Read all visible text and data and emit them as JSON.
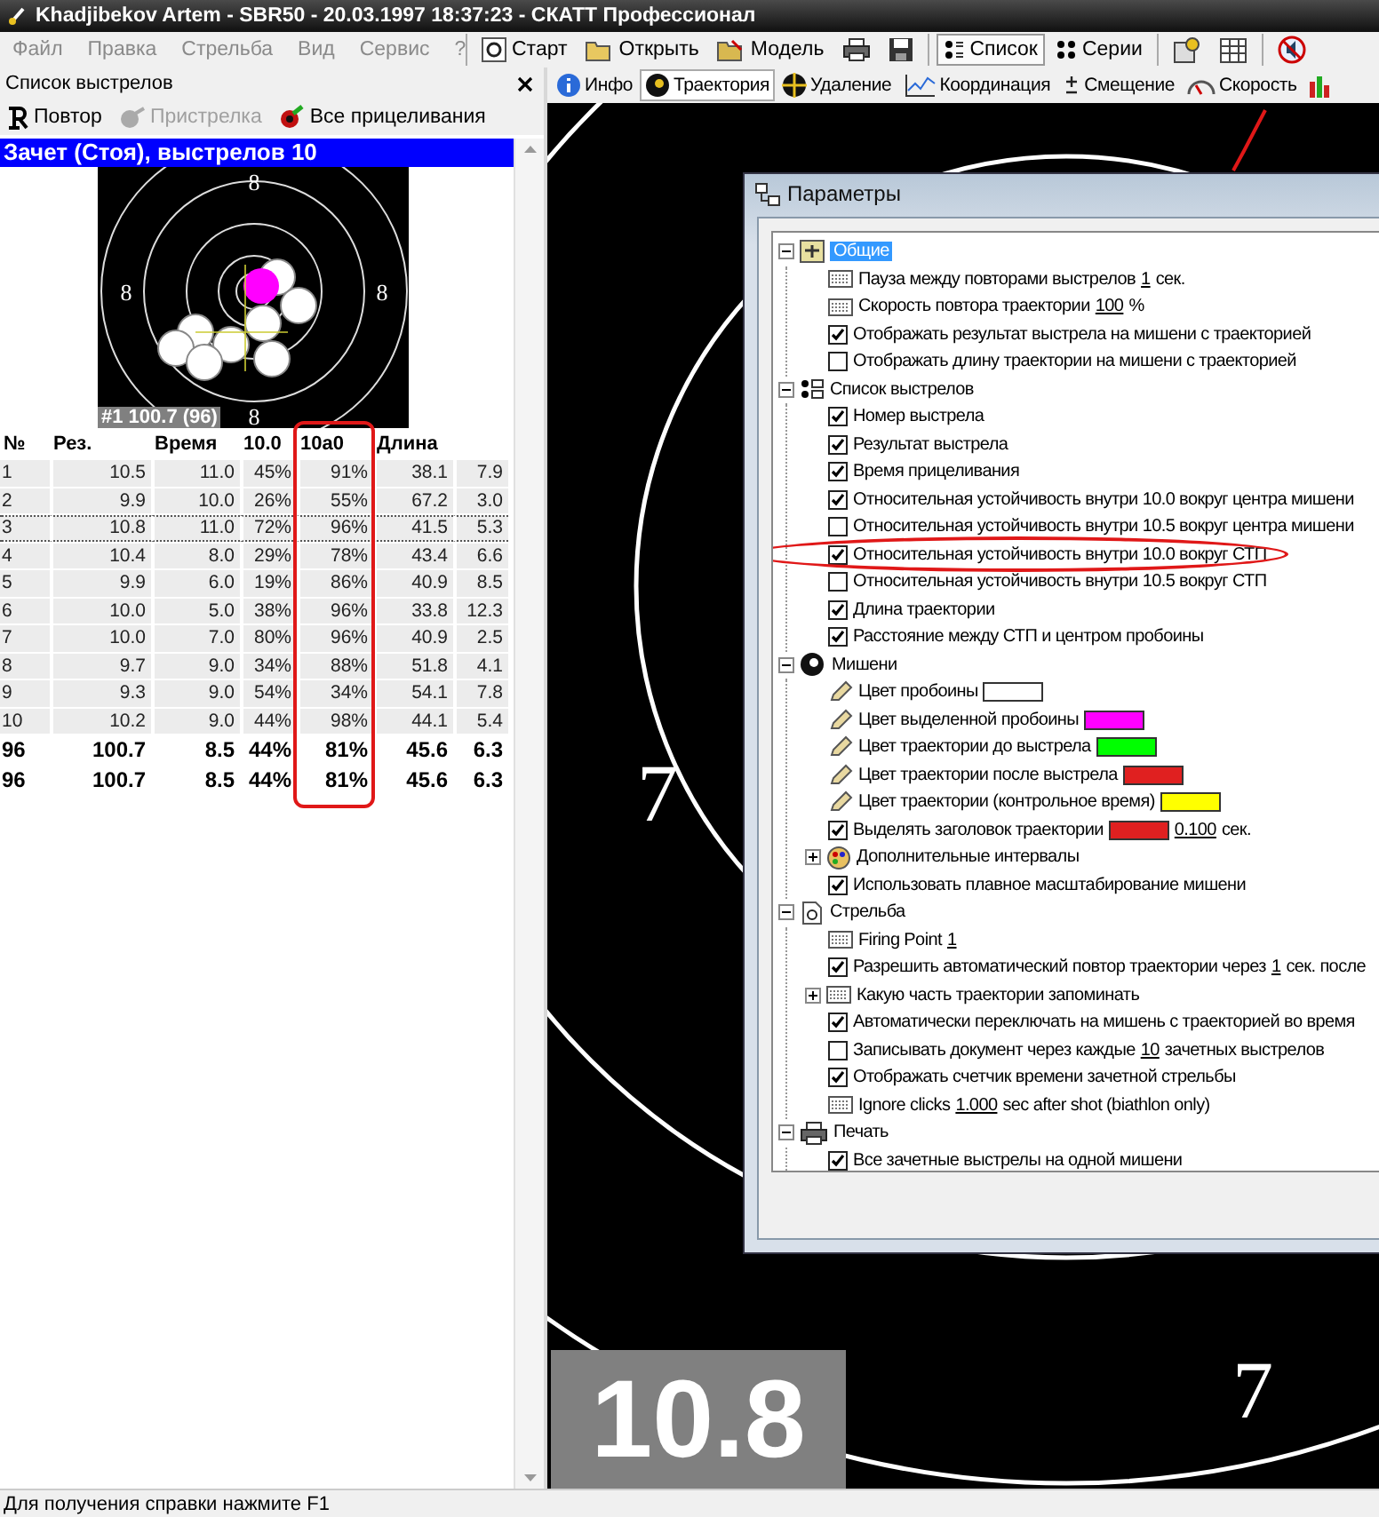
{
  "window": {
    "title": "Khadjibekov Artem - SBR50 - 20.03.1997 18:37:23 - СКАТТ Профессионал"
  },
  "menu": [
    {
      "label": "Файл",
      "disabled": true
    },
    {
      "label": "Правка",
      "disabled": true
    },
    {
      "label": "Стрельба",
      "disabled": true
    },
    {
      "label": "Вид",
      "disabled": true
    },
    {
      "label": "Сервис",
      "disabled": true
    },
    {
      "label": "?",
      "disabled": true
    }
  ],
  "toolbar": {
    "groups": [
      [
        {
          "kind": "start",
          "label": "Старт",
          "pressed": false
        },
        {
          "kind": "open",
          "label": "Открыть",
          "pressed": false
        },
        {
          "kind": "model",
          "label": "Модель",
          "pressed": false
        },
        {
          "kind": "print",
          "pressed": false
        },
        {
          "kind": "save",
          "pressed": false
        }
      ],
      [
        {
          "kind": "list",
          "label": "Список",
          "pressed": true
        },
        {
          "kind": "series",
          "label": "Серии",
          "pressed": false
        }
      ],
      [
        {
          "kind": "settings",
          "pressed": false
        },
        {
          "kind": "export",
          "pressed": false
        }
      ],
      [
        {
          "kind": "mute",
          "pressed": false
        }
      ]
    ]
  },
  "shot_panel": {
    "title": "Список выстрелов",
    "actions": [
      {
        "kind": "replay",
        "label": "Повтор",
        "disabled": false
      },
      {
        "kind": "zeroing",
        "label": "Пристрелка",
        "disabled": true
      },
      {
        "kind": "aims",
        "label": "Все прицеливания",
        "disabled": false
      }
    ],
    "group_header": "Зачет (Стоя), выстрелов 10",
    "mini_target": {
      "ring_labels": [
        "8",
        "8",
        "8",
        "8"
      ],
      "caption": "#1 100.7 (96)"
    },
    "table": {
      "columns": [
        {
          "label": "№"
        },
        {
          "label": "Рез."
        },
        {
          "label": "Время"
        },
        {
          "label": "10.0"
        },
        {
          "label": "10a0",
          "highlighted": true
        },
        {
          "label": "Длина"
        }
      ],
      "rows": [
        {
          "focused": false,
          "cells": [
            "1",
            "10.5",
            "11.0",
            "45%",
            "91%",
            "38.1",
            "7.9"
          ]
        },
        {
          "focused": false,
          "cells": [
            "2",
            "9.9",
            "10.0",
            "26%",
            "55%",
            "67.2",
            "3.0"
          ]
        },
        {
          "focused": true,
          "cells": [
            "3",
            "10.8",
            "11.0",
            "72%",
            "96%",
            "41.5",
            "5.3"
          ]
        },
        {
          "focused": false,
          "cells": [
            "4",
            "10.4",
            "8.0",
            "29%",
            "78%",
            "43.4",
            "6.6"
          ]
        },
        {
          "focused": false,
          "cells": [
            "5",
            "9.9",
            "6.0",
            "19%",
            "86%",
            "40.9",
            "8.5"
          ]
        },
        {
          "focused": false,
          "cells": [
            "6",
            "10.0",
            "5.0",
            "38%",
            "96%",
            "33.8",
            "12.3"
          ]
        },
        {
          "focused": false,
          "cells": [
            "7",
            "10.0",
            "7.0",
            "80%",
            "96%",
            "40.9",
            "2.5"
          ]
        },
        {
          "focused": false,
          "cells": [
            "8",
            "9.7",
            "9.0",
            "34%",
            "88%",
            "51.8",
            "4.1"
          ]
        },
        {
          "focused": false,
          "cells": [
            "9",
            "9.3",
            "9.0",
            "54%",
            "34%",
            "54.1",
            "7.8"
          ]
        },
        {
          "focused": false,
          "cells": [
            "10",
            "10.2",
            "9.0",
            "44%",
            "98%",
            "44.1",
            "5.4"
          ]
        }
      ],
      "totals": [
        [
          "96",
          "100.7",
          "8.5",
          "44%",
          "81%",
          "45.6",
          "6.3"
        ],
        [
          "96",
          "100.7",
          "8.5",
          "44%",
          "81%",
          "45.6",
          "6.3"
        ]
      ]
    }
  },
  "view_tabs": [
    {
      "kind": "info",
      "label": "Инфо",
      "selected": false
    },
    {
      "kind": "trajectory",
      "label": "Траектория",
      "selected": true
    },
    {
      "kind": "distance",
      "label": "Удаление",
      "selected": false
    },
    {
      "kind": "coordination",
      "label": "Координация",
      "selected": false
    },
    {
      "kind": "offset",
      "label": "Смещение",
      "selected": false
    },
    {
      "kind": "speed",
      "label": "Скорость",
      "selected": false
    },
    {
      "kind": "chart",
      "selected": false
    }
  ],
  "big_target": {
    "ring_labels": [
      "7",
      "7"
    ],
    "score": "10.8"
  },
  "dialog": {
    "title": "Параметры",
    "sections": [
      {
        "kind": "general",
        "label": "Общие",
        "selected": true,
        "expanded": true,
        "children": [
          {
            "kind": "value",
            "label": "Пауза между повторами выстрелов ",
            "value": "1",
            "suffix": " сек."
          },
          {
            "kind": "value",
            "label": "Скорость повтора траектории ",
            "value": "100",
            "suffix": " %"
          },
          {
            "kind": "checkbox",
            "label": "Отображать результат выстрела на мишени с траекторией",
            "checked": true
          },
          {
            "kind": "checkbox",
            "label": "Отображать длину траектории на мишени с траекторией",
            "checked": false
          }
        ]
      },
      {
        "kind": "list",
        "label": "Список выстрелов",
        "selected": false,
        "expanded": true,
        "children": [
          {
            "kind": "checkbox",
            "label": "Номер выстрела",
            "checked": true
          },
          {
            "kind": "checkbox",
            "label": "Результат выстрела",
            "checked": true
          },
          {
            "kind": "checkbox",
            "label": "Время прицеливания",
            "checked": true
          },
          {
            "kind": "checkbox",
            "label": "Относительная устойчивость внутри 10.0 вокруг центра мишени",
            "checked": true
          },
          {
            "kind": "checkbox",
            "label": "Относительная устойчивость внутри 10.5 вокруг центра мишени",
            "checked": false
          },
          {
            "kind": "checkbox",
            "label": "Относительная устойчивость внутри 10.0 вокруг СТП",
            "checked": true,
            "highlighted": true
          },
          {
            "kind": "checkbox",
            "label": "Относительная устойчивость внутри 10.5 вокруг СТП",
            "checked": false
          },
          {
            "kind": "checkbox",
            "label": "Длина траектории",
            "checked": true
          },
          {
            "kind": "checkbox",
            "label": "Расстояние между СТП и центром пробоины",
            "checked": true
          }
        ]
      },
      {
        "kind": "target",
        "label": "Мишени",
        "selected": false,
        "expanded": true,
        "children": [
          {
            "kind": "color",
            "label": "Цвет пробоины",
            "color": "#ffffff"
          },
          {
            "kind": "color",
            "label": "Цвет выделенной пробоины",
            "color": "#ff00ff"
          },
          {
            "kind": "color",
            "label": "Цвет траектории до выстрела",
            "color": "#00ff00"
          },
          {
            "kind": "color",
            "label": "Цвет траектории после выстрела",
            "color": "#e02020"
          },
          {
            "kind": "color",
            "label": "Цвет траектории (контрольное время)",
            "color": "#ffff00"
          },
          {
            "kind": "checkbox",
            "label": "Выделять заголовок траектории",
            "checked": true,
            "color": "#e02020",
            "value": "0.100",
            "suffix": " сек."
          },
          {
            "kind": "palette_group",
            "label": "Дополнительные интервалы",
            "expanded": false
          },
          {
            "kind": "checkbox",
            "label": "Использовать плавное масштабирование мишени",
            "checked": true
          }
        ]
      },
      {
        "kind": "shooting",
        "label": "Стрельба",
        "selected": false,
        "expanded": true,
        "children": [
          {
            "kind": "value",
            "label": "Firing Point ",
            "value": "1"
          },
          {
            "kind": "checkbox",
            "label": "Разрешить автоматический повтор траектории через ",
            "checked": true,
            "value": "1",
            "suffix": " сек. после"
          },
          {
            "kind": "value_group",
            "label": "Какую часть траектории запоминать",
            "expanded": false
          },
          {
            "kind": "checkbox",
            "label": "Автоматически переключать на мишень с траекторией во время",
            "checked": true
          },
          {
            "kind": "checkbox",
            "label": "Записывать документ через каждые ",
            "checked": false,
            "value": "10",
            "suffix": " зачетных выстрелов"
          },
          {
            "kind": "checkbox",
            "label": "Отображать счетчик времени зачетной стрельбы",
            "checked": true
          },
          {
            "kind": "value",
            "label": "Ignore clicks ",
            "value": "1.000",
            "suffix": " sec after shot (biathlon only)"
          }
        ]
      },
      {
        "kind": "print",
        "label": "Печать",
        "selected": false,
        "expanded": true,
        "children": [
          {
            "kind": "checkbox",
            "label": "Все зачетные выстрелы на одной мишени",
            "checked": true
          }
        ]
      }
    ]
  },
  "status_bar": "Для получения справки нажмите F1"
}
